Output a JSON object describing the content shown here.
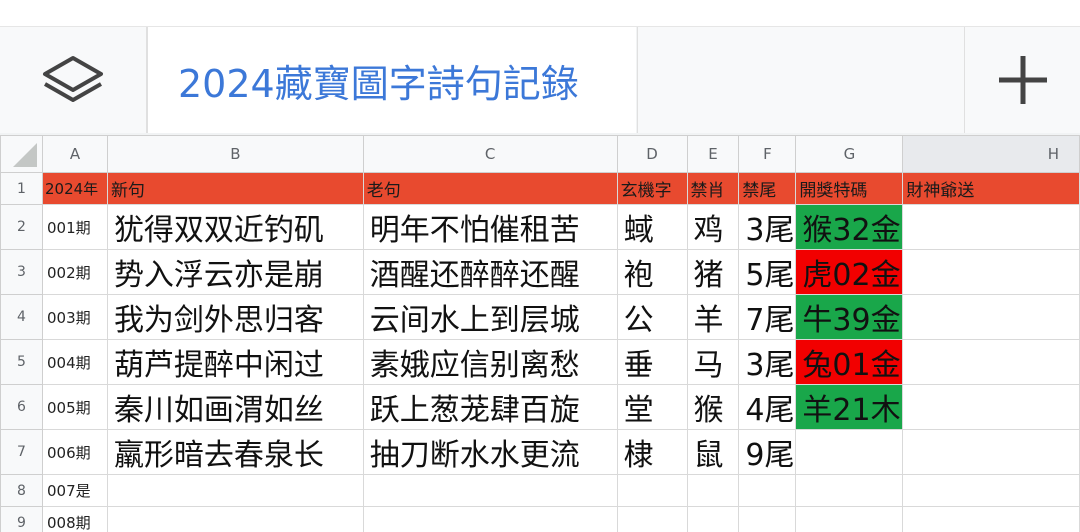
{
  "title": "2024藏寶圖字詩句記錄",
  "icons": {
    "layers": "layers-icon",
    "add": "plus-icon"
  },
  "columns": [
    "A",
    "B",
    "C",
    "D",
    "E",
    "F",
    "G",
    "H"
  ],
  "row_numbers": [
    "1",
    "2",
    "3",
    "4",
    "5",
    "6",
    "7",
    "8",
    "9"
  ],
  "header_row": {
    "a": "2024年",
    "b": "新句",
    "c": "老句",
    "d": "玄機字",
    "e": "禁肖",
    "f": "禁尾",
    "g": "開獎特碼",
    "h": "財神爺送"
  },
  "rows": [
    {
      "a": "001期",
      "b": "犹得双双近钓矶",
      "c": "明年不怕催租苦",
      "d": "蜮",
      "e": "鸡",
      "f": "3尾",
      "g": "猴32金",
      "g_color": "#19a74a"
    },
    {
      "a": "002期",
      "b": "势入浮云亦是崩",
      "c": "酒醒还醉醉还醒",
      "d": "袍",
      "e": "猪",
      "f": "5尾",
      "g": "虎02金",
      "g_color": "#f20000"
    },
    {
      "a": "003期",
      "b": "我为剑外思归客",
      "c": "云间水上到层城",
      "d": "公",
      "e": "羊",
      "f": "7尾",
      "g": "牛39金",
      "g_color": "#19a74a"
    },
    {
      "a": "004期",
      "b": "葫芦提醉中闲过",
      "c": "素娥应信别离愁",
      "d": "垂",
      "e": "马",
      "f": "3尾",
      "g": "兔01金",
      "g_color": "#f20000"
    },
    {
      "a": "005期",
      "b": "秦川如画渭如丝",
      "c": "跃上葱茏肆百旋",
      "d": "堂",
      "e": "猴",
      "f": "4尾",
      "g": "羊21木",
      "g_color": "#19a74a"
    },
    {
      "a": "006期",
      "b": "羸形暗去春泉长",
      "c": "抽刀断水水更流",
      "d": "棣",
      "e": "鼠",
      "f": "9尾",
      "g": "",
      "g_color": ""
    },
    {
      "a": "007是",
      "b": "",
      "c": "",
      "d": "",
      "e": "",
      "f": "",
      "g": "",
      "g_color": ""
    },
    {
      "a": "008期",
      "b": "",
      "c": "",
      "d": "",
      "e": "",
      "f": "",
      "g": "",
      "g_color": ""
    }
  ],
  "colors": {
    "header_fill": "#e84a2f",
    "win_green": "#19a74a",
    "win_red": "#f20000",
    "title_blue": "#3c78d8"
  }
}
